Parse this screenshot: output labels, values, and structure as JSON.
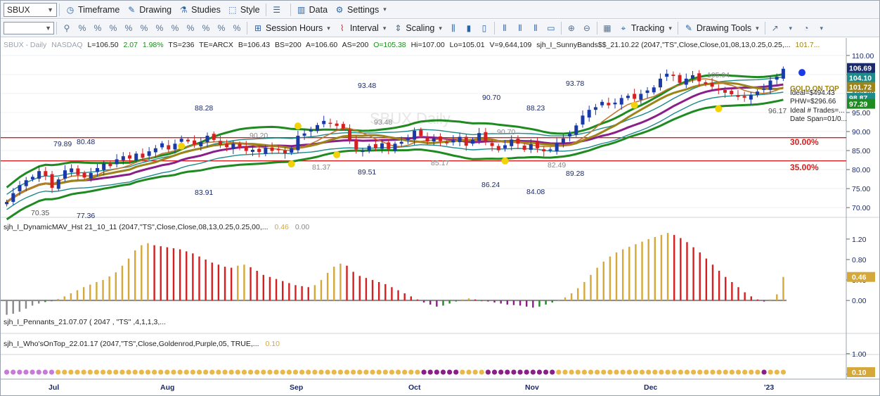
{
  "symbol": "SBUX",
  "toolbar1": [
    {
      "label": "Timeframe",
      "icon": "clock-icon"
    },
    {
      "label": "Drawing",
      "icon": "pencil-icon"
    },
    {
      "label": "Studies",
      "icon": "studies-icon"
    },
    {
      "label": "Style",
      "icon": "style-icon"
    },
    {
      "label": "",
      "icon": "layout-icon"
    },
    {
      "label": "Data",
      "icon": "data-icon"
    },
    {
      "label": "Settings",
      "icon": "gear-icon"
    }
  ],
  "toolbar2": [
    {
      "label": "Session Hours",
      "icon": "session-icon"
    },
    {
      "label": "Interval",
      "icon": "interval-icon"
    },
    {
      "label": "Scaling",
      "icon": "scaling-icon"
    },
    {
      "label": "Tracking",
      "icon": "tracking-icon"
    },
    {
      "label": "Drawing Tools",
      "icon": "drawing-tools-icon"
    }
  ],
  "status": {
    "title": "SBUX - Daily",
    "exchange": "NASDAQ",
    "last": "L=106.50",
    "change": "2.07",
    "pct": "1.98%",
    "ts": "TS=236",
    "te": "TE=ARCX",
    "bid": "B=106.43",
    "bs": "BS=200",
    "ask": "A=106.60",
    "as": "AS=200",
    "open": "O=105.38",
    "hi": "Hi=107.00",
    "lo": "Lo=105.01",
    "vol": "V=9,644,109",
    "study": "sjh_I_SunnyBands$$_21.10.22 (2047,\"TS\",Close,Close,01,08,13,0.25,0.25,...",
    "study_value": "101.7..."
  },
  "colors": {
    "up": "#1a3aa8",
    "down": "#d42020",
    "band": "#1f8a1f",
    "teal": "#1f8a8a",
    "gold": "#9c8418",
    "purple": "#8a1f8a",
    "goldbar": "#d4a83a",
    "dot": "#f2d20a"
  },
  "chart_data": [
    {
      "type": "candlestick",
      "title": "SBUX - Daily",
      "y_ticks": [
        70.0,
        75.0,
        80.0,
        85.0,
        90.0,
        95.0,
        100.0,
        105.0,
        110.0
      ],
      "ylim": [
        68.0,
        112.0
      ],
      "x_labels": [
        "Jul",
        "Aug",
        "Sep",
        "Oct",
        "Nov",
        "Dec",
        "'23"
      ],
      "price_tags": [
        "106.69",
        "104.10",
        "101.72",
        "98.87",
        "97.29"
      ],
      "annotations": [
        "93.48",
        "88.28",
        "90.70",
        "93.78",
        "88.23",
        "79.89",
        "80.48",
        "70.35",
        "77.36",
        "83.91",
        "89.51",
        "86.24",
        "84.08",
        "89.28",
        "96.17",
        "105.94",
        "81.37",
        "93.48",
        "90.70",
        "82.49",
        "85.17",
        "90.20",
        "30.00%",
        "35.00%"
      ],
      "side_text": [
        "GOLD ON TOP",
        "Ideal=$494.43",
        "PHW=$296.66",
        "Ideal # Trades=...",
        "Date Span=01/0..."
      ],
      "levels": [
        88.4,
        82.3
      ],
      "watermark": "SBUX Daily",
      "closes": [
        71.5,
        73.8,
        75.9,
        77.2,
        78.1,
        79.6,
        78.3,
        75.2,
        77.4,
        79.8,
        80.3,
        78.6,
        77.9,
        79.1,
        80.4,
        81.6,
        80.9,
        82.7,
        83.5,
        82.9,
        84.2,
        83.1,
        84.8,
        85.6,
        86.9,
        85.3,
        86.8,
        88.1,
        87.4,
        86.6,
        87.2,
        88.9,
        87.8,
        86.5,
        85.9,
        86.8,
        85.7,
        84.9,
        85.2,
        84.6,
        85.8,
        84.9,
        85.3,
        84.2,
        85.6,
        88.9,
        89.5,
        90.4,
        91.7,
        92.8,
        92.1,
        91.5,
        90.8,
        87.6,
        85.3,
        84.9,
        86.2,
        85.7,
        86.9,
        85.4,
        86.8,
        87.3,
        88.1,
        90.2,
        88.9,
        87.4,
        88.2,
        87.5,
        86.9,
        87.7,
        88.6,
        86.3,
        87.8,
        89.6,
        87.5,
        86.2,
        85.1,
        86.4,
        87.9,
        86.8,
        85.2,
        86.7,
        85.6,
        84.8,
        85.3,
        86.9,
        88.2,
        89.4,
        91.6,
        94.2,
        95.7,
        96.4,
        97.8,
        96.9,
        97.6,
        98.8,
        99.4,
        98.6,
        99.9,
        100.8,
        101.6,
        103.9,
        105.2,
        104.6,
        102.8,
        103.9,
        104.8,
        103.2,
        102.5,
        101.8,
        100.9,
        100.2,
        99.8,
        99.1,
        98.9,
        99.6,
        100.5,
        101.2,
        103.4,
        104.4,
        106.5
      ]
    },
    {
      "type": "bar",
      "title": "sjh_I_DynamicMAV_Hst 21_10_11 (2047,\"TS\",Close,Close,08,13,0.25,0.25,00,...",
      "values_shown": [
        "0.46",
        "0.00"
      ],
      "y_ticks": [
        0.0,
        0.4,
        0.8,
        1.2
      ],
      "ylim": [
        -0.3,
        1.35
      ],
      "last_tag": "0.46",
      "values": [
        -0.28,
        -0.26,
        -0.22,
        -0.16,
        -0.1,
        -0.06,
        -0.03,
        -0.01,
        0.03,
        0.08,
        0.14,
        0.2,
        0.26,
        0.31,
        0.36,
        0.4,
        0.47,
        0.55,
        0.68,
        0.82,
        0.98,
        1.08,
        1.12,
        1.08,
        1.06,
        1.04,
        1.02,
        1.0,
        0.96,
        0.92,
        0.86,
        0.8,
        0.74,
        0.7,
        0.66,
        0.64,
        0.68,
        0.7,
        0.65,
        0.58,
        0.5,
        0.46,
        0.42,
        0.38,
        0.34,
        0.3,
        0.28,
        0.26,
        0.3,
        0.4,
        0.54,
        0.66,
        0.72,
        0.68,
        0.56,
        0.48,
        0.44,
        0.4,
        0.36,
        0.32,
        0.26,
        0.2,
        0.14,
        0.08,
        0.02,
        -0.04,
        -0.08,
        -0.12,
        -0.1,
        -0.06,
        -0.02,
        0.02,
        0.04,
        0.02,
        0.0,
        -0.02,
        -0.04,
        -0.06,
        -0.08,
        -0.09,
        -0.1,
        -0.12,
        -0.14,
        -0.12,
        -0.08,
        -0.04,
        0.0,
        0.06,
        0.14,
        0.24,
        0.36,
        0.5,
        0.64,
        0.76,
        0.86,
        0.94,
        1.0,
        1.05,
        1.1,
        1.15,
        1.2,
        1.24,
        1.28,
        1.32,
        1.28,
        1.22,
        1.14,
        1.04,
        0.94,
        0.82,
        0.7,
        0.58,
        0.46,
        0.36,
        0.26,
        0.16,
        0.08,
        0.02,
        -0.02,
        0.02,
        0.12,
        0.46
      ]
    },
    {
      "type": "line",
      "title": "sjh_I_Pennants_21.07.07 ( 2047 , \"TS\" ,4,1,1,3,..."
    },
    {
      "type": "scatter",
      "title": "sjh_I_Who'sOnTop_22.01.17 (2047,\"TS\",Close,Goldenrod,Purple,05, TRUE,...",
      "value_shown": "0.10",
      "y_ticks": [
        0.0,
        1.0
      ],
      "last_tag": "0.10"
    }
  ]
}
